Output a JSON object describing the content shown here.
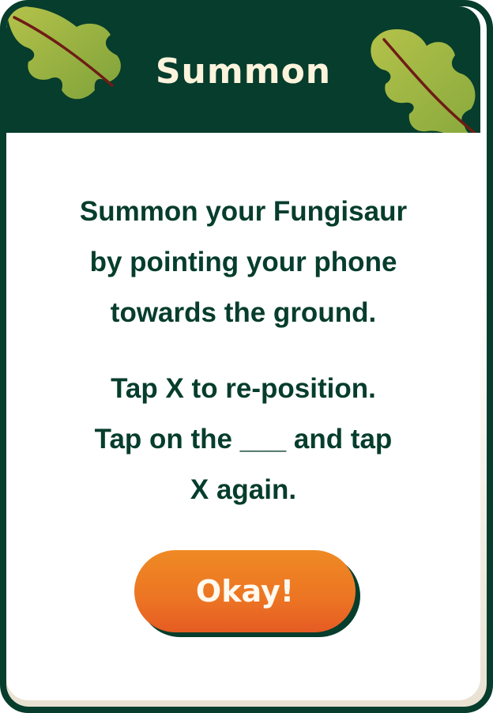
{
  "header": {
    "title": "Summon"
  },
  "message": {
    "line1": "Summon your Fungisaur",
    "line2": "by pointing your phone",
    "line3": "towards the ground.",
    "line4": "Tap X to re-position.",
    "line5": "Tap on the ___ and tap",
    "line6": "X again."
  },
  "actions": {
    "okay_label": "Okay!"
  },
  "colors": {
    "dark_green": "#063d2c",
    "cream": "#fbf3dc",
    "orange": "#ec7423",
    "leaf_green": "#8fb03c",
    "leaf_vein": "#6e1c16"
  },
  "decorations": [
    "leaf-icon",
    "leaf-icon"
  ]
}
